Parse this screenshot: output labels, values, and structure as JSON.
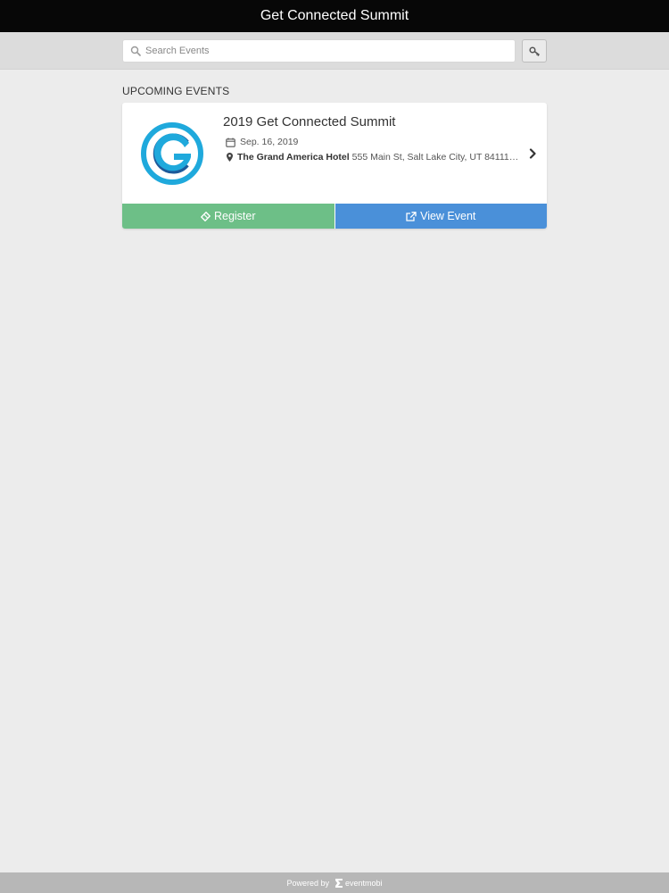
{
  "app": {
    "title": "Get Connected Summit"
  },
  "search": {
    "placeholder": "Search Events",
    "value": "",
    "icon": "search-icon",
    "key_button_icon": "key-icon"
  },
  "section": {
    "title": "UPCOMING EVENTS"
  },
  "events": [
    {
      "title": "2019 Get Connected Summit",
      "date": "Sep. 16, 2019",
      "venue": "The Grand America Hotel",
      "address": "555 Main St, Salt Lake City, UT 84111, ...",
      "logo_icon": "gc-logo-icon",
      "register_label": "Register",
      "view_label": "View Event"
    }
  ],
  "footer": {
    "powered_by": "Powered by",
    "brand": "eventmobi"
  },
  "colors": {
    "topbar": "#070707",
    "register": "#6dbf87",
    "view_event": "#4a90d9",
    "logo_light": "#1fa9dc",
    "logo_dark": "#1d5a9a"
  }
}
